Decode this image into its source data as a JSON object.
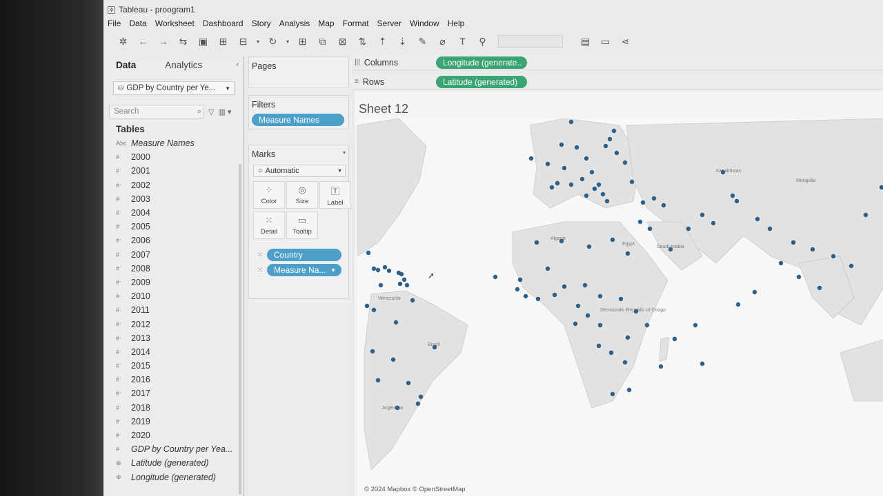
{
  "window": {
    "title": "Tableau - proogram1"
  },
  "menu": [
    "File",
    "Data",
    "Worksheet",
    "Dashboard",
    "Story",
    "Analysis",
    "Map",
    "Format",
    "Server",
    "Window",
    "Help"
  ],
  "toolbar_icons": [
    "tableau-logo-icon",
    "undo-icon",
    "redo-icon",
    "swap-icon",
    "save-icon",
    "new-datasource-icon",
    "pause-icon",
    "refresh-icon",
    "new-sheet-icon",
    "duplicate-icon",
    "clear-sheet-icon",
    "swap-rows-cols-icon",
    "sort-asc-icon",
    "sort-desc-icon",
    "highlight-icon",
    "group-icon",
    "label-icon",
    "fix-axes-icon",
    "fit-icon",
    "presentation-icon",
    "share-icon"
  ],
  "data_pane": {
    "tabs": [
      "Data",
      "Analytics"
    ],
    "datasource": "GDP by Country per Ye...",
    "search_placeholder": "Search",
    "tables_header": "Tables",
    "fields": [
      {
        "type": "Abc",
        "name": "Measure Names",
        "italic": true
      },
      {
        "type": "#",
        "name": "2000"
      },
      {
        "type": "#",
        "name": "2001"
      },
      {
        "type": "#",
        "name": "2002"
      },
      {
        "type": "#",
        "name": "2003"
      },
      {
        "type": "#",
        "name": "2004"
      },
      {
        "type": "#",
        "name": "2005"
      },
      {
        "type": "#",
        "name": "2006"
      },
      {
        "type": "#",
        "name": "2007"
      },
      {
        "type": "#",
        "name": "2008"
      },
      {
        "type": "#",
        "name": "2009"
      },
      {
        "type": "#",
        "name": "2010"
      },
      {
        "type": "#",
        "name": "2011"
      },
      {
        "type": "#",
        "name": "2012"
      },
      {
        "type": "#",
        "name": "2013"
      },
      {
        "type": "#",
        "name": "2014"
      },
      {
        "type": "#",
        "name": "2015"
      },
      {
        "type": "#",
        "name": "2016"
      },
      {
        "type": "#",
        "name": "2017"
      },
      {
        "type": "#",
        "name": "2018"
      },
      {
        "type": "#",
        "name": "2019"
      },
      {
        "type": "#",
        "name": "2020"
      },
      {
        "type": "#",
        "name": "GDP by Country per Yea...",
        "italic": true
      },
      {
        "type": "⊕",
        "name": "Latitude (generated)",
        "italic": true
      },
      {
        "type": "⊕",
        "name": "Longitude (generated)",
        "italic": true
      }
    ]
  },
  "shelves": {
    "pages_label": "Pages",
    "filters_label": "Filters",
    "filter_pill": "Measure Names",
    "marks_label": "Marks",
    "mark_type": "Automatic",
    "mark_buttons": [
      "Color",
      "Size",
      "Label",
      "Detail",
      "Tooltip"
    ],
    "mark_pills": [
      "Country",
      "Measure Na..."
    ]
  },
  "columns": {
    "label": "Columns",
    "pill": "Longitude (generate.."
  },
  "rows": {
    "label": "Rows",
    "pill": "Latitude (generated)"
  },
  "sheet": {
    "title": "Sheet 12",
    "attribution": "© 2024 Mapbox © OpenStreetMap",
    "map_labels": [
      "Kazakhstan",
      "Mongolia",
      "Algeria",
      "Egypt",
      "Saudi Arabia",
      "Democratic Republic of Congo",
      "Venezuela",
      "Brazil",
      "Argentina"
    ]
  },
  "colors": {
    "pill_blue": "#4c9fc8",
    "pill_green": "#3aa572",
    "dot": "#2c5f8a",
    "land": "#e2e2e2",
    "water": "#f7f7f7"
  }
}
